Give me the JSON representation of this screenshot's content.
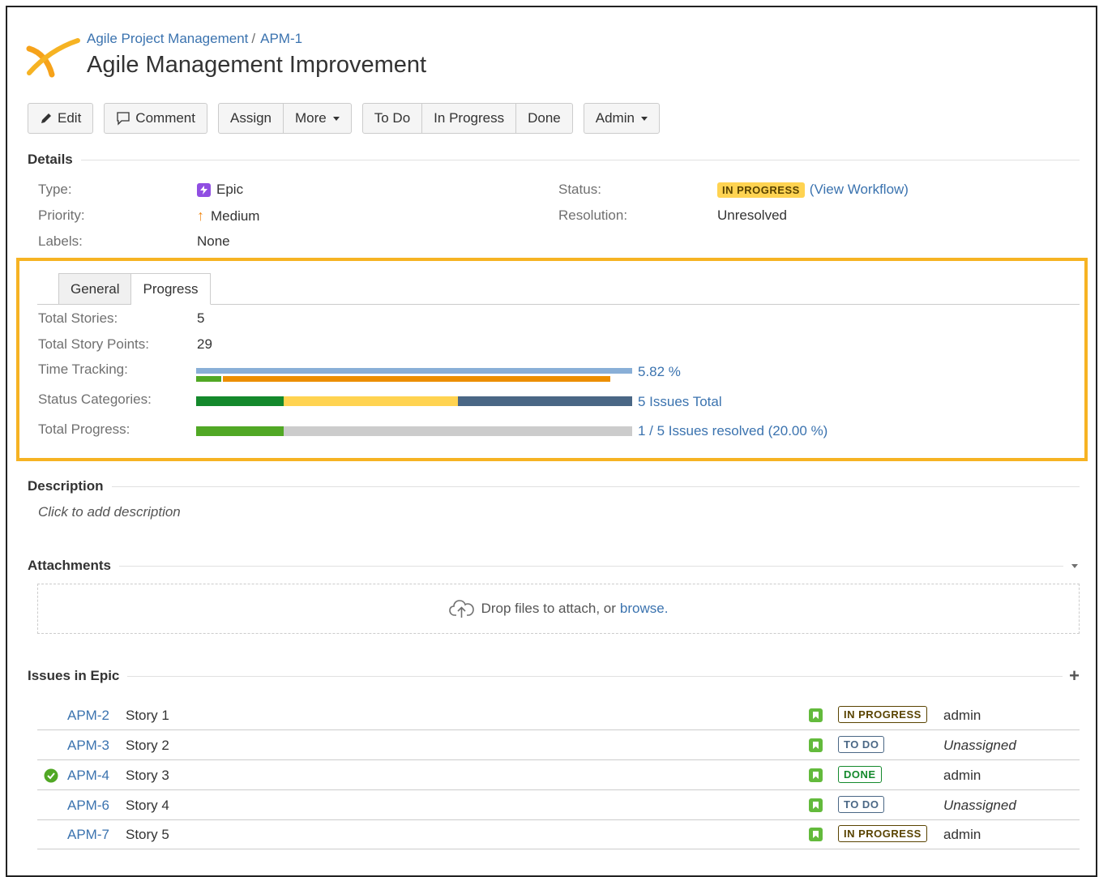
{
  "breadcrumb": {
    "project": "Agile Project Management",
    "separator": "/",
    "issue_key": "APM-1"
  },
  "title": "Agile Management Improvement",
  "toolbar": {
    "edit": "Edit",
    "comment": "Comment",
    "assign": "Assign",
    "more": "More",
    "todo": "To Do",
    "in_progress": "In Progress",
    "done": "Done",
    "admin": "Admin"
  },
  "details": {
    "heading": "Details",
    "type_label": "Type:",
    "type_value": "Epic",
    "priority_label": "Priority:",
    "priority_value": "Medium",
    "labels_label": "Labels:",
    "labels_value": "None",
    "status_label": "Status:",
    "status_value": "IN PROGRESS",
    "view_workflow": "(View Workflow)",
    "resolution_label": "Resolution:",
    "resolution_value": "Unresolved"
  },
  "tabs": {
    "general": "General",
    "progress": "Progress"
  },
  "progress": {
    "total_stories_label": "Total Stories:",
    "total_stories": "5",
    "total_points_label": "Total Story Points:",
    "total_points": "29",
    "time_tracking_label": "Time Tracking:",
    "time_tracking_text": "5.82 %",
    "status_categories_label": "Status Categories:",
    "status_categories_text": "5 Issues Total",
    "total_progress_label": "Total Progress:",
    "total_progress_text": "1 / 5 Issues resolved (20.00 %)",
    "time_tracking_logged_fraction": 0.0582,
    "status_done_fraction": 0.2,
    "status_in_progress_fraction": 0.4,
    "status_todo_fraction": 0.4,
    "resolved_fraction": 0.2
  },
  "description": {
    "heading": "Description",
    "placeholder": "Click to add description"
  },
  "attachments": {
    "heading": "Attachments",
    "drop_text": "Drop files to attach, or ",
    "browse": "browse."
  },
  "issues": {
    "heading": "Issues in Epic",
    "rows": [
      {
        "key": "APM-2",
        "summary": "Story 1",
        "status": "IN PROGRESS",
        "assignee": "admin"
      },
      {
        "key": "APM-3",
        "summary": "Story 2",
        "status": "TO DO",
        "assignee": "Unassigned"
      },
      {
        "key": "APM-4",
        "summary": "Story 3",
        "status": "DONE",
        "assignee": "admin"
      },
      {
        "key": "APM-6",
        "summary": "Story 4",
        "status": "TO DO",
        "assignee": "Unassigned"
      },
      {
        "key": "APM-7",
        "summary": "Story 5",
        "status": "IN PROGRESS",
        "assignee": "admin"
      }
    ]
  },
  "colors": {
    "link": "#3b73af",
    "highlight": "#f6b323",
    "done_green": "#14892c",
    "in_progress_yellow": "#ffd351",
    "todo_blue": "#4a6785",
    "time_original": "#89afd7",
    "time_logged": "#51a825",
    "time_remaining": "#ec8e00"
  }
}
